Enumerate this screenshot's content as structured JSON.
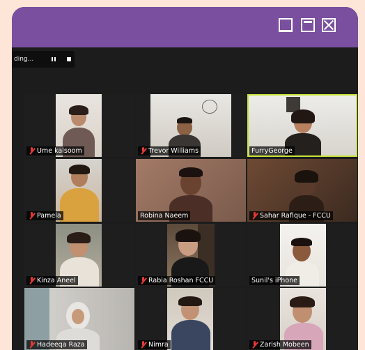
{
  "window": {
    "controls": [
      "minimize-icon",
      "maximize-icon",
      "close-icon"
    ],
    "accent": "#7b4fa0"
  },
  "recording": {
    "status": "ding...",
    "pause_icon": "pause-icon",
    "stop_icon": "stop-icon"
  },
  "participants": [
    {
      "name": "Ume kalsoom",
      "muted": true
    },
    {
      "name": "Trevor Williams",
      "muted": true
    },
    {
      "name": "FurryGeorge",
      "muted": false,
      "active_speaker": true
    },
    {
      "name": "Pamela",
      "muted": true
    },
    {
      "name": "Robina Naeem",
      "muted": false
    },
    {
      "name": "Sahar Rafique - FCCU",
      "muted": true
    },
    {
      "name": "Kinza Aneel",
      "muted": true
    },
    {
      "name": "Rabia Roshan FCCU",
      "muted": true
    },
    {
      "name": "Sunil's iPhone",
      "muted": false
    },
    {
      "name": "Hadeeqa Raza",
      "muted": true
    },
    {
      "name": "Nimra",
      "muted": true
    },
    {
      "name": "Zarish Mobeen",
      "muted": true
    }
  ]
}
